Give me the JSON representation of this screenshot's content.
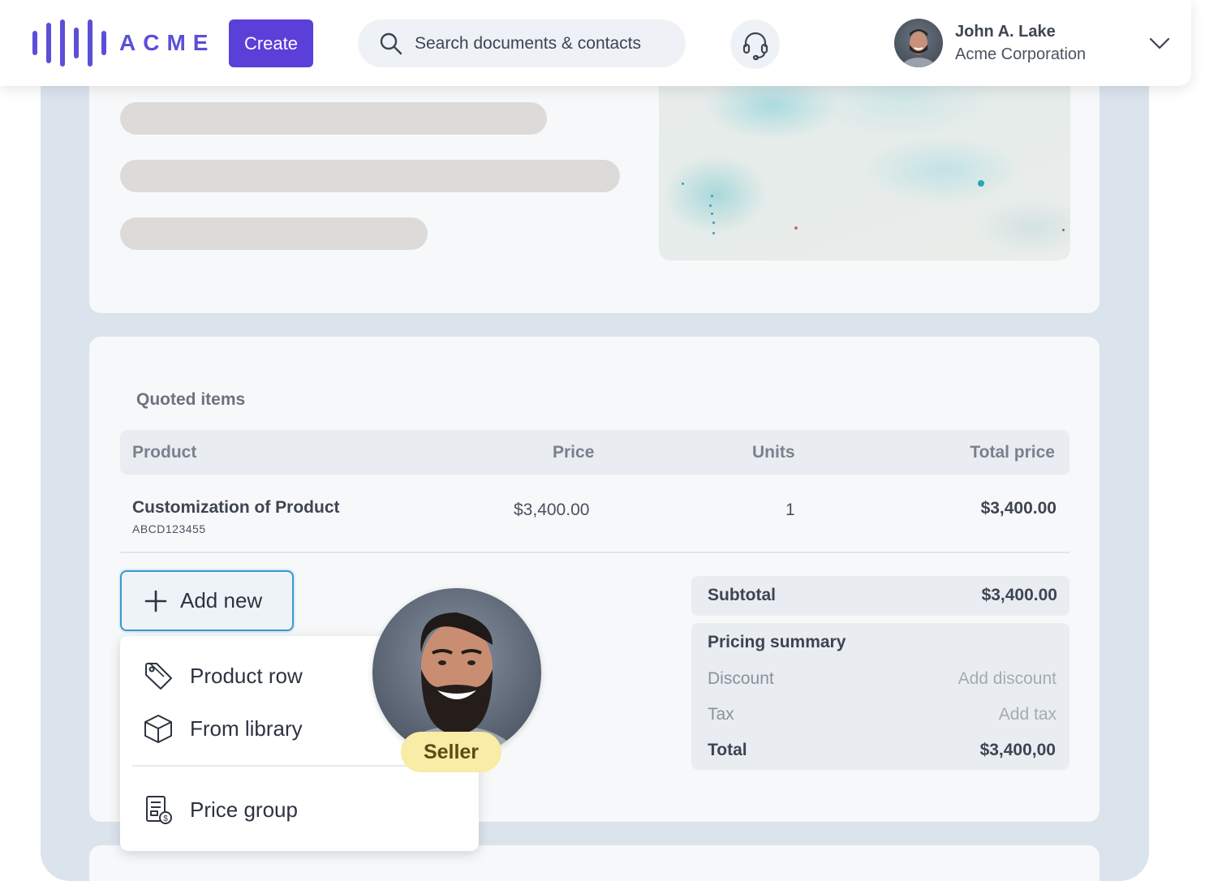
{
  "header": {
    "logo_text": "ACME",
    "create_label": "Create",
    "search_placeholder": "Search documents & contacts",
    "user": {
      "name": "John A. Lake",
      "company": "Acme Corporation"
    }
  },
  "quote": {
    "section_title": "Quoted items",
    "columns": [
      "Product",
      "Price",
      "Units",
      "Total price"
    ],
    "rows": [
      {
        "product": "Customization of Product",
        "sku": "ABCD123455",
        "price": "$3,400.00",
        "units": "1",
        "total": "$3,400.00"
      }
    ],
    "add_new_label": "Add new",
    "menu": [
      {
        "label": "Product row",
        "icon": "tag-icon"
      },
      {
        "label": "From library",
        "icon": "box-icon"
      },
      {
        "label": "Price group",
        "icon": "price-group-icon"
      }
    ],
    "seller_tag": "Seller",
    "subtotal": {
      "label": "Subtotal",
      "value": "$3,400.00"
    },
    "summary": {
      "title": "Pricing summary",
      "discount": {
        "label": "Discount",
        "action": "Add discount"
      },
      "tax": {
        "label": "Tax",
        "action": "Add tax"
      },
      "total": {
        "label": "Total",
        "value": "$3,400,00"
      }
    }
  },
  "colors": {
    "brand": "#5a3fd9",
    "backdrop": "#dbe3ec",
    "add_button_border": "#3c98c8",
    "seller_tag": "#f8eca6"
  }
}
